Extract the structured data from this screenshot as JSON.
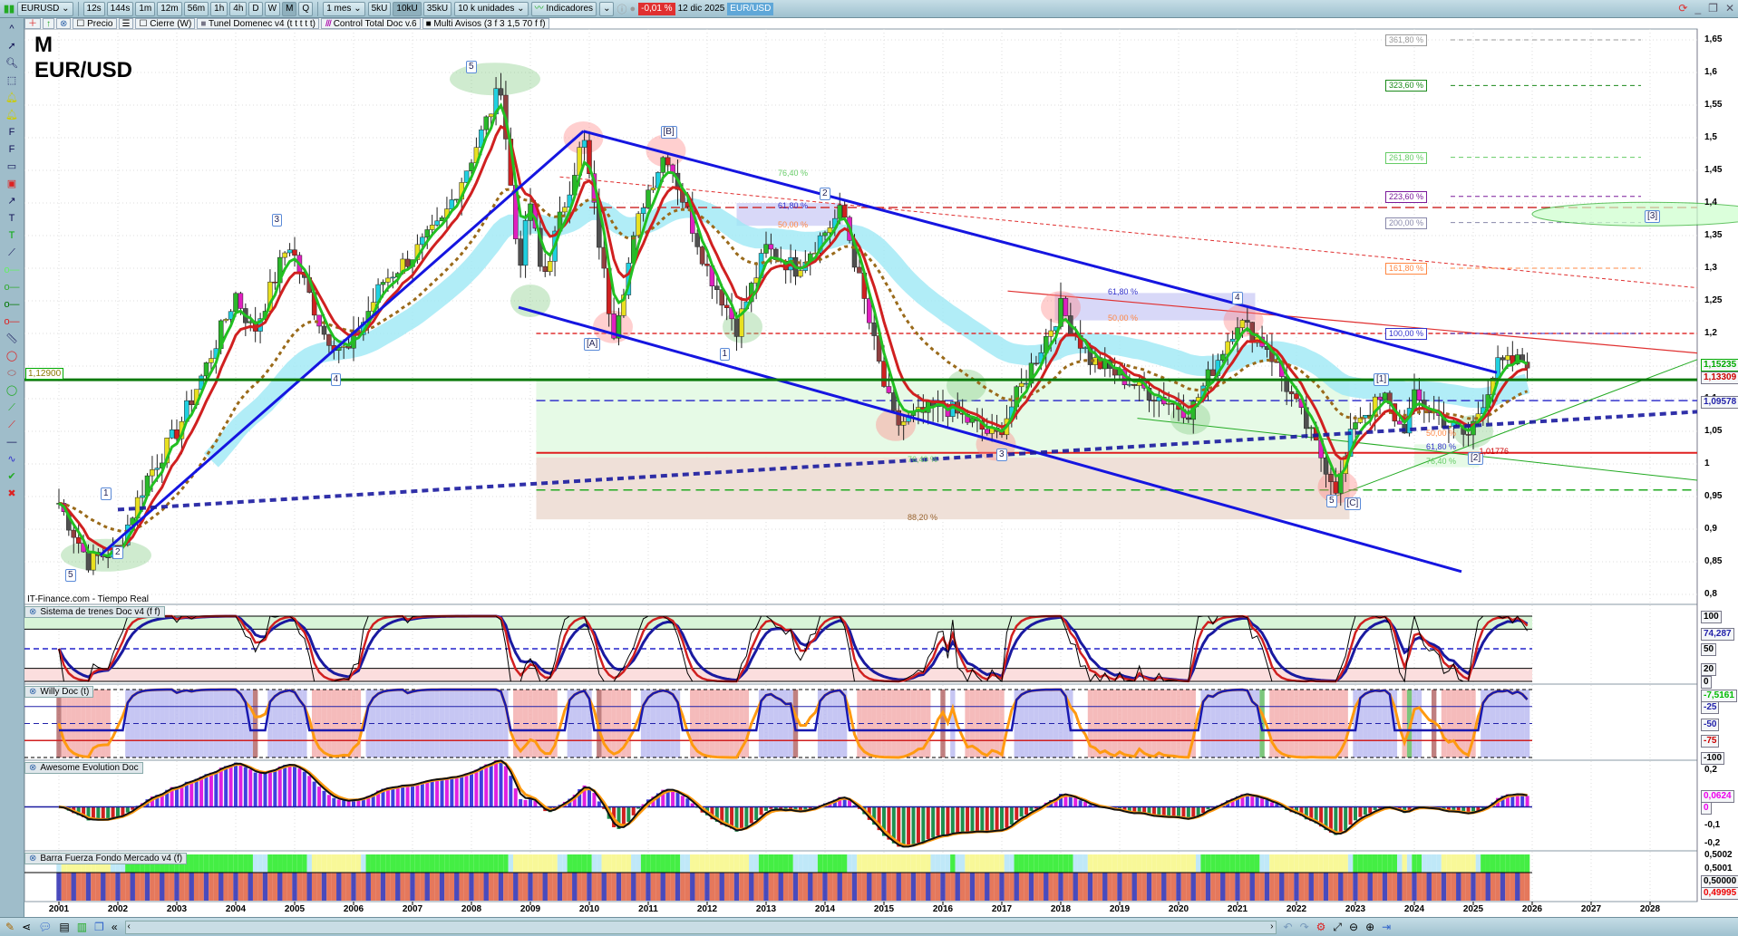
{
  "toolbar": {
    "symbol": "EURUSD",
    "timeframes": [
      "12s",
      "144s",
      "1m",
      "12m",
      "56m",
      "1h",
      "4h",
      "D",
      "W",
      "M",
      "Q"
    ],
    "active_timeframe": "M",
    "period": "1 mes",
    "units_buttons": [
      "5kU",
      "10kU",
      "35kU"
    ],
    "active_unit": "10kU",
    "units": "10 k unidades",
    "indicators": "Indicadores",
    "change": "-0,01 %",
    "date": "12 dic 2025",
    "pair_badge": "EUR/USD"
  },
  "legend_row": {
    "precio": "Precio",
    "cierre": "Cierre (W)",
    "tunel": "Tunel Domenec v4 (t t t t t)",
    "control": "Control Total Doc v.6",
    "avisos": "Multi Avisos (3 f 3 1,5 70 f f)"
  },
  "title": {
    "period": "M",
    "pair": "EUR/USD"
  },
  "source": "IT-Finance.com - Tiempo Real",
  "price_axis": [
    "1,65",
    "1,6",
    "1,55",
    "1,5",
    "1,45",
    "1,4",
    "1,35",
    "1,3",
    "1,25",
    "1,2",
    "1,15",
    "1,1",
    "1,05",
    "1",
    "0,95",
    "0,9",
    "0,85",
    "0,8"
  ],
  "price_markers": {
    "current": "1,15235",
    "red": "1,13309",
    "blue": "1,09578",
    "hline": "1,12900",
    "low_2": "1,01776"
  },
  "fib_labels": [
    {
      "t": "361,80 %",
      "p": 1.65,
      "c": "#999"
    },
    {
      "t": "323,60 %",
      "p": 1.58,
      "c": "#1a8a1a"
    },
    {
      "t": "261,80 %",
      "p": 1.47,
      "c": "#6c6"
    },
    {
      "t": "223,60 %",
      "p": 1.41,
      "c": "#7a1a9a"
    },
    {
      "t": "200,00 %",
      "p": 1.37,
      "c": "#88a"
    },
    {
      "t": "161,80 %",
      "p": 1.3,
      "c": "#f84"
    },
    {
      "t": "100,00 %",
      "p": 1.2,
      "c": "#33c"
    }
  ],
  "zone_labels": [
    {
      "t": "76,40 %",
      "y": 2013.2,
      "p": 1.445,
      "c": "#6c6"
    },
    {
      "t": "61,80 %",
      "y": 2013.2,
      "p": 1.395,
      "c": "#33c"
    },
    {
      "t": "50,00 %",
      "y": 2013.2,
      "p": 1.365,
      "c": "#f84"
    },
    {
      "t": "61,80 %",
      "y": 2018.8,
      "p": 1.262,
      "c": "#33c"
    },
    {
      "t": "50,00 %",
      "y": 2018.8,
      "p": 1.222,
      "c": "#f84"
    },
    {
      "t": "76,40 %",
      "y": 2015.4,
      "p": 1.005,
      "c": "#6c6"
    },
    {
      "t": "88,20 %",
      "y": 2015.4,
      "p": 0.917,
      "c": "#963"
    },
    {
      "t": "50,00 %",
      "y": 2024.2,
      "p": 1.046,
      "c": "#f84"
    },
    {
      "t": "61,80 %",
      "y": 2024.2,
      "p": 1.025,
      "c": "#33c"
    },
    {
      "t": "76,40 %",
      "y": 2024.2,
      "p": 1.003,
      "c": "#6c6"
    }
  ],
  "wave_labels": [
    {
      "t": "5",
      "y": 2001.2,
      "p": 0.83
    },
    {
      "t": "1",
      "y": 2001.8,
      "p": 0.955
    },
    {
      "t": "2",
      "y": 2002.0,
      "p": 0.865
    },
    {
      "t": "3",
      "y": 2004.7,
      "p": 1.375
    },
    {
      "t": "4",
      "y": 2005.7,
      "p": 1.13
    },
    {
      "t": "5",
      "y": 2008.0,
      "p": 1.61
    },
    {
      "t": "[A]",
      "y": 2010.0,
      "p": 1.185
    },
    {
      "t": "[B]",
      "y": 2011.3,
      "p": 1.51
    },
    {
      "t": "1",
      "y": 2012.3,
      "p": 1.17
    },
    {
      "t": "2",
      "y": 2014.0,
      "p": 1.415
    },
    {
      "t": "3",
      "y": 2017.0,
      "p": 1.015
    },
    {
      "t": "4",
      "y": 2021.0,
      "p": 1.255
    },
    {
      "t": "5",
      "y": 2022.6,
      "p": 0.945
    },
    {
      "t": "[C]",
      "y": 2022.9,
      "p": 0.94
    },
    {
      "t": "[1]",
      "y": 2023.4,
      "p": 1.13
    },
    {
      "t": "[2]",
      "y": 2025.0,
      "p": 1.01
    },
    {
      "t": "[3]",
      "y": 2028.0,
      "p": 1.38
    }
  ],
  "panes": {
    "sistema": "Sistema de trenes Doc v4 (f f)",
    "willy": "Willy Doc (t)",
    "awesome": "Awesome Evolution Doc",
    "barra": "Barra Fuerza Fondo Mercado v4 (f)"
  },
  "sistema_axis": [
    "100",
    "74,287",
    "50",
    "20",
    "0"
  ],
  "willy_axis": [
    "-7,5161",
    "-25",
    "-50",
    "-75",
    "-100"
  ],
  "awesome_axis": [
    "0,2",
    "0,0624",
    "0",
    "-0,1",
    "-0,2"
  ],
  "barra_axis": [
    "0,5002",
    "0,5001",
    "0,50000",
    "0,49995"
  ],
  "years": [
    "2001",
    "2002",
    "2003",
    "2004",
    "2005",
    "2006",
    "2007",
    "2008",
    "2009",
    "2010",
    "2011",
    "2012",
    "2013",
    "2014",
    "2015",
    "2016",
    "2017",
    "2018",
    "2019",
    "2020",
    "2021",
    "2022",
    "2023",
    "2024",
    "2025",
    "2026",
    "2027",
    "2028"
  ],
  "chart_data": {
    "type": "candlestick",
    "title": "EUR/USD",
    "timeframe": "monthly",
    "x_unit": "year",
    "ylim": [
      0.8,
      1.65
    ],
    "price_path": [
      [
        2001.0,
        0.94
      ],
      [
        2001.5,
        0.85
      ],
      [
        2002.0,
        0.87
      ],
      [
        2002.5,
        0.98
      ],
      [
        2003.0,
        1.05
      ],
      [
        2003.5,
        1.15
      ],
      [
        2004.0,
        1.26
      ],
      [
        2004.3,
        1.2
      ],
      [
        2004.9,
        1.34
      ],
      [
        2005.5,
        1.2
      ],
      [
        2005.9,
        1.17
      ],
      [
        2006.5,
        1.28
      ],
      [
        2007.0,
        1.32
      ],
      [
        2007.5,
        1.37
      ],
      [
        2008.0,
        1.47
      ],
      [
        2008.5,
        1.58
      ],
      [
        2008.8,
        1.3
      ],
      [
        2009.0,
        1.4
      ],
      [
        2009.2,
        1.28
      ],
      [
        2009.9,
        1.5
      ],
      [
        2010.4,
        1.2
      ],
      [
        2010.9,
        1.4
      ],
      [
        2011.3,
        1.48
      ],
      [
        2012.0,
        1.3
      ],
      [
        2012.5,
        1.21
      ],
      [
        2013.0,
        1.33
      ],
      [
        2013.5,
        1.3
      ],
      [
        2014.3,
        1.39
      ],
      [
        2015.0,
        1.12
      ],
      [
        2015.2,
        1.06
      ],
      [
        2016.0,
        1.09
      ],
      [
        2016.9,
        1.04
      ],
      [
        2018.0,
        1.24
      ],
      [
        2018.5,
        1.16
      ],
      [
        2019.5,
        1.11
      ],
      [
        2020.2,
        1.08
      ],
      [
        2021.0,
        1.22
      ],
      [
        2021.5,
        1.18
      ],
      [
        2022.7,
        0.96
      ],
      [
        2023.0,
        1.07
      ],
      [
        2023.5,
        1.1
      ],
      [
        2023.8,
        1.05
      ],
      [
        2024.0,
        1.1
      ],
      [
        2024.9,
        1.04
      ],
      [
        2025.4,
        1.15
      ],
      [
        2025.95,
        1.16
      ]
    ],
    "hline": 1.129,
    "trendlines": [
      {
        "name": "channel-upper",
        "from": [
          2009.9,
          1.51
        ],
        "to": [
          2025.4,
          1.14
        ],
        "color": "#1515e0"
      },
      {
        "name": "channel-lower",
        "from": [
          2008.8,
          1.24
        ],
        "to": [
          2024.8,
          0.835
        ],
        "color": "#1515e0"
      },
      {
        "name": "rising-line",
        "from": [
          2001.7,
          0.86
        ],
        "to": [
          2009.9,
          1.51
        ],
        "color": "#1515e0"
      }
    ]
  },
  "colors": {
    "up": "#22aa22",
    "down": "#d02020",
    "channel": "#1515e0",
    "hline": "#0a7a0a",
    "cloud": "#9ee8f5"
  }
}
